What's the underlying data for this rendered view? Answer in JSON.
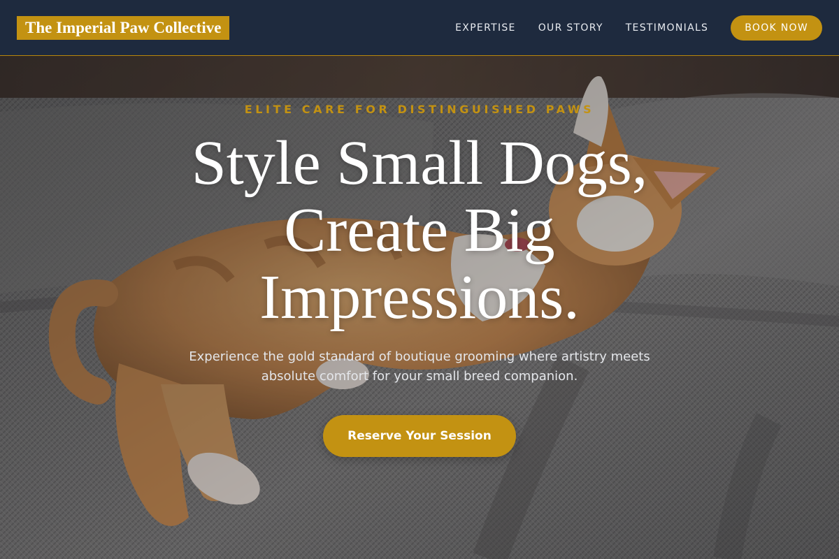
{
  "header": {
    "logo_text": "The Imperial Paw Collective",
    "nav": [
      {
        "label": "EXPERTISE"
      },
      {
        "label": "OUR STORY"
      },
      {
        "label": "TESTIMONIALS"
      }
    ],
    "cta_label": "BOOK NOW"
  },
  "hero": {
    "background_image": "orange-and-white-cat-lying-on-grey-couch",
    "eyebrow": "ELITE CARE FOR DISTINGUISHED PAWS",
    "headline": "Style Small Dogs, Create Big Impressions.",
    "subtext": "Experience the gold standard of boutique grooming where artistry meets absolute comfort for your small breed companion.",
    "cta_label": "Reserve Your Session"
  },
  "colors": {
    "header_bg": "#1e2a3e",
    "accent_gold": "#c39212",
    "text_light": "#ffffff"
  }
}
